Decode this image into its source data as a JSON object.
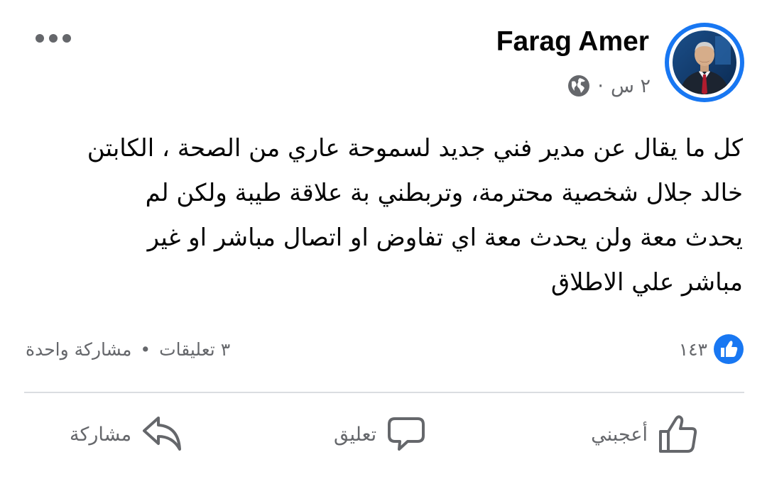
{
  "post": {
    "author": "Farag Amer",
    "time": "٢ س",
    "separator": "·",
    "privacy_icon": "globe-icon",
    "menu_icon": "more-horizontal-icon",
    "text": "كل ما يقال عن مدير فني جديد لسموحة عاري من الصحة ، الكابتن\nخالد جلال شخصية محترمة، وتربطني بة علاقة طيبة ولكن لم\nيحدث معة  ولن يحدث معة اي تفاوض او اتصال مباشر او غير\nمباشر علي الاطلاق"
  },
  "stats": {
    "like_count": "١٤٣",
    "like_icon": "like-reaction-icon",
    "comments": "٣ تعليقات",
    "bullet": "•",
    "shares": "مشاركة واحدة"
  },
  "actions": {
    "like_label": "أعجبني",
    "like_icon": "thumbs-up-icon",
    "comment_label": "تعليق",
    "comment_icon": "speech-bubble-icon",
    "share_label": "مشاركة",
    "share_icon": "share-arrow-icon"
  },
  "colors": {
    "brand_blue": "#1877f2",
    "text_primary": "#050505",
    "text_secondary": "#65676b",
    "divider": "#dadde1"
  }
}
